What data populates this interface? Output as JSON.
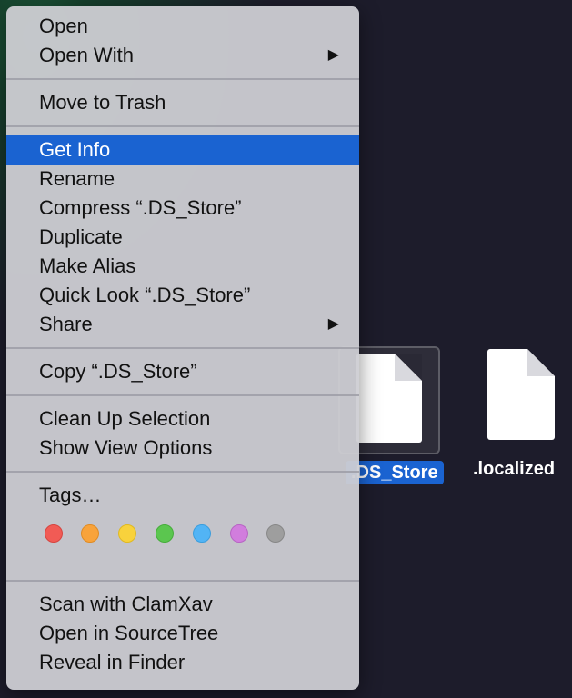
{
  "desktop": {
    "files": [
      {
        "label": ".DS_Store",
        "selected": true
      },
      {
        "label": ".localized",
        "selected": false
      }
    ]
  },
  "menu": {
    "group1": [
      "Open",
      "Open With"
    ],
    "group2": [
      "Move to Trash"
    ],
    "group3": [
      "Get Info",
      "Rename",
      "Compress “.DS_Store”",
      "Duplicate",
      "Make Alias",
      "Quick Look “.DS_Store”",
      "Share"
    ],
    "group4": [
      "Copy “.DS_Store”"
    ],
    "group5": [
      "Clean Up Selection",
      "Show View Options"
    ],
    "tags_label": "Tags…",
    "tag_colors": [
      {
        "name": "red",
        "fill": "#f15b55",
        "border": "#d64540"
      },
      {
        "name": "orange",
        "fill": "#f8a33b",
        "border": "#e08b23"
      },
      {
        "name": "yellow",
        "fill": "#f8d23c",
        "border": "#e0b922"
      },
      {
        "name": "green",
        "fill": "#5bc64f",
        "border": "#46ad3b"
      },
      {
        "name": "blue",
        "fill": "#52b4f5",
        "border": "#3a9ddd"
      },
      {
        "name": "purple",
        "fill": "#d17ddd",
        "border": "#b764c4"
      },
      {
        "name": "gray",
        "fill": "#9e9e9e",
        "border": "#878787"
      }
    ],
    "group6": [
      "Scan with ClamXav",
      "Open in SourceTree",
      "Reveal in Finder"
    ],
    "submenu_arrow": "▶",
    "highlight_color": "#1a63d1"
  }
}
